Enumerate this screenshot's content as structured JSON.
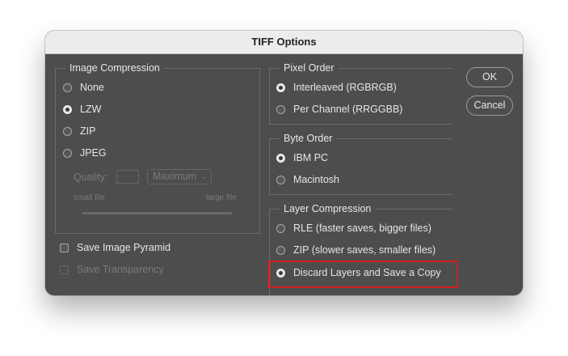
{
  "dialog": {
    "title": "TIFF Options"
  },
  "image_compression": {
    "label": "Image Compression",
    "options": [
      "None",
      "LZW",
      "ZIP",
      "JPEG"
    ],
    "selected": "LZW",
    "quality_label": "Quality:",
    "quality_value": "",
    "quality_select": "Maximum",
    "small_file_label": "small file",
    "large_file_label": "large file"
  },
  "pixel_order": {
    "label": "Pixel Order",
    "options": [
      "Interleaved (RGBRGB)",
      "Per Channel (RRGGBB)"
    ],
    "selected": "Interleaved (RGBRGB)"
  },
  "byte_order": {
    "label": "Byte Order",
    "options": [
      "IBM PC",
      "Macintosh"
    ],
    "selected": "IBM PC"
  },
  "layer_compression": {
    "label": "Layer Compression",
    "options": [
      "RLE (faster saves, bigger files)",
      "ZIP (slower saves, smaller files)",
      "Discard Layers and Save a Copy"
    ],
    "selected": "Discard Layers and Save a Copy"
  },
  "checkboxes": {
    "save_image_pyramid": {
      "label": "Save Image Pyramid",
      "checked": false
    },
    "save_transparency": {
      "label": "Save Transparency",
      "checked": false,
      "disabled": true
    }
  },
  "buttons": {
    "ok": "OK",
    "cancel": "Cancel"
  },
  "colors": {
    "highlight": "#d21c1c",
    "dialog_bg": "#4d4d4d",
    "titlebar_bg": "#ececec"
  }
}
